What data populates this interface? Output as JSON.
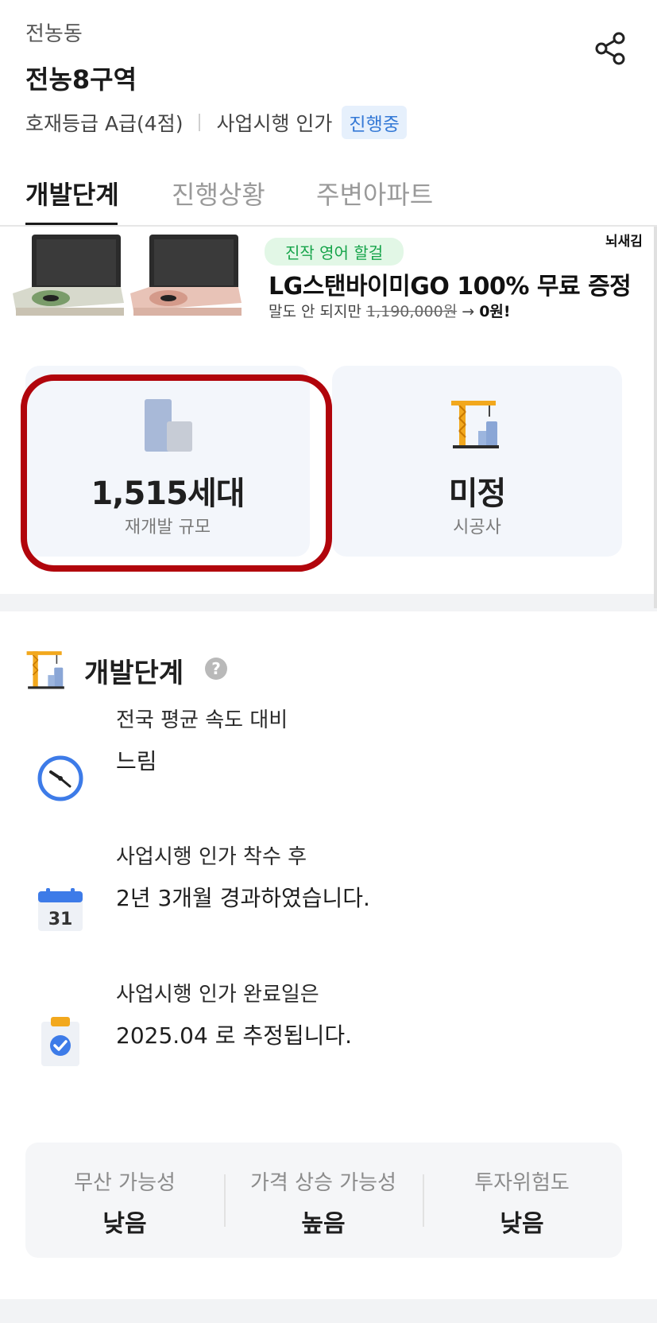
{
  "header": {
    "dong": "전농동",
    "area_title": "전농8구역",
    "grade": "호재등급 A급(4점)",
    "stage": "사업시행 인가",
    "badge": "진행중"
  },
  "tabs": [
    {
      "label": "개발단계",
      "active": true
    },
    {
      "label": "진행상황",
      "active": false
    },
    {
      "label": "주변아파트",
      "active": false
    }
  ],
  "ad": {
    "pill": "진작 영어 할걸",
    "title": "LG스탠바이미GO 100% 무료 증정",
    "sub_prefix": "말도 안 되지만 ",
    "sub_strike": "1,190,000원",
    "sub_arrow": " → ",
    "sub_price": "0원!",
    "corner": "뇌새김"
  },
  "stats": {
    "scale": {
      "value": "1,515세대",
      "label": "재개발 규모"
    },
    "builder": {
      "value": "미정",
      "label": "시공사"
    }
  },
  "development": {
    "title": "개발단계",
    "help": "?",
    "rows": [
      {
        "icon": "clock-icon",
        "line1": "전국 평균 속도 대비",
        "line2": "느림"
      },
      {
        "icon": "calendar-icon",
        "line1": "사업시행 인가 착수 후",
        "line2": "2년 3개월 경과하였습니다.",
        "calendar_day": "31"
      },
      {
        "icon": "clipboard-check-icon",
        "line1": "사업시행 인가 완료일은",
        "line2": "2025.04 로 추정됩니다."
      }
    ],
    "summary": [
      {
        "title": "무산 가능성",
        "value": "낮음"
      },
      {
        "title": "가격 상승 가능성",
        "value": "높음"
      },
      {
        "title": "투자위험도",
        "value": "낮음"
      }
    ]
  },
  "colors": {
    "accent_blue": "#3479d6",
    "highlight_red": "#b1050c",
    "card_bg": "#f3f6fb"
  }
}
